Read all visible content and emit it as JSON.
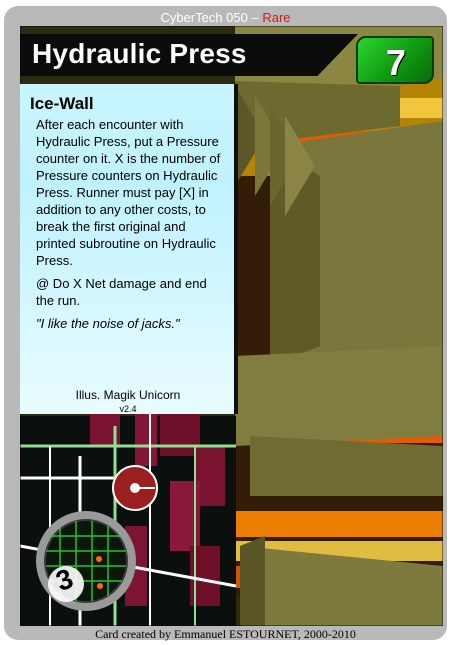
{
  "card": {
    "set_line": "CyberTech 050",
    "rarity": "Rare",
    "name": "Hydraulic Press",
    "cost": "7",
    "type": "Ice-Wall",
    "rules": [
      "After each encounter with Hydraulic Press, put a Pressure counter on it. X is the number of Pressure counters on Hydraulic Press. Runner must pay [X] in addition to any other costs, to break the first original and printed subroutine on Hydraulic Press.",
      "@ Do X Net damage and end the run."
    ],
    "flavor": "\"I like the noise of jacks.\"",
    "illustrator": "Illus. Magik Unicorn",
    "version": "v2.4",
    "footer": "Card created by Emmanuel ESTOURNET, 2000-2010",
    "subroutine_icon_label": "3"
  },
  "colors": {
    "frame": "#b9b9b9",
    "title_bar": "#0b0b0b",
    "cost_green": "#109a12",
    "textbox_cyan": "#c9f6ff",
    "rarity_red": "#d11b1b"
  }
}
